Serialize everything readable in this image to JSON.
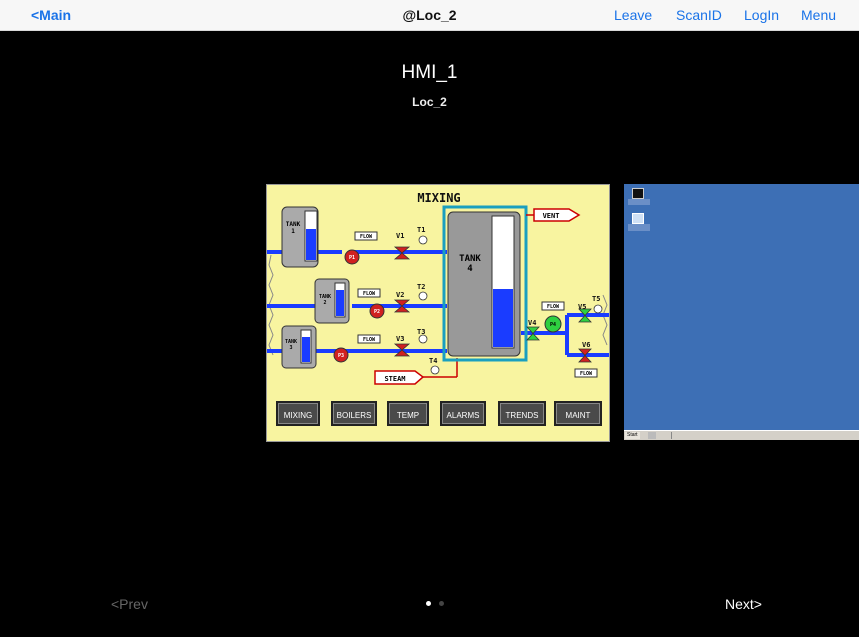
{
  "navbar": {
    "back_label": "<Main",
    "title": "@Loc_2",
    "actions": [
      "Leave",
      "ScanID",
      "LogIn",
      "Menu"
    ]
  },
  "header": {
    "title": "HMI_1",
    "subtitle": "Loc_2"
  },
  "hmi": {
    "title": "MIXING",
    "tanks": [
      "TANK\n1",
      "TANK\n2",
      "TANK\n3",
      "TANK\n4"
    ],
    "valves": [
      "V1",
      "V2",
      "V3",
      "V4",
      "V5",
      "V6"
    ],
    "temps": [
      "T1",
      "T2",
      "T3",
      "T4",
      "T5"
    ],
    "pumps": [
      "P1",
      "P2",
      "P3",
      "P4"
    ],
    "flow_label": "FLOW",
    "vent_label": "VENT",
    "steam_label": "STEAM",
    "buttons": [
      "MIXING",
      "BOILERS",
      "TEMP",
      "ALARMS",
      "TRENDS",
      "MAINT"
    ]
  },
  "desktop_preview": {
    "start_label": "Start"
  },
  "pager": {
    "prev_label": "<Prev",
    "next_label": "Next>",
    "page_count": 2,
    "current_page": 1
  },
  "colors": {
    "accent": "#1a73e8",
    "hmi_bg": "#f8f4a0",
    "pipe": "#1a3cff",
    "desktop_bg": "#3d6fb5"
  }
}
